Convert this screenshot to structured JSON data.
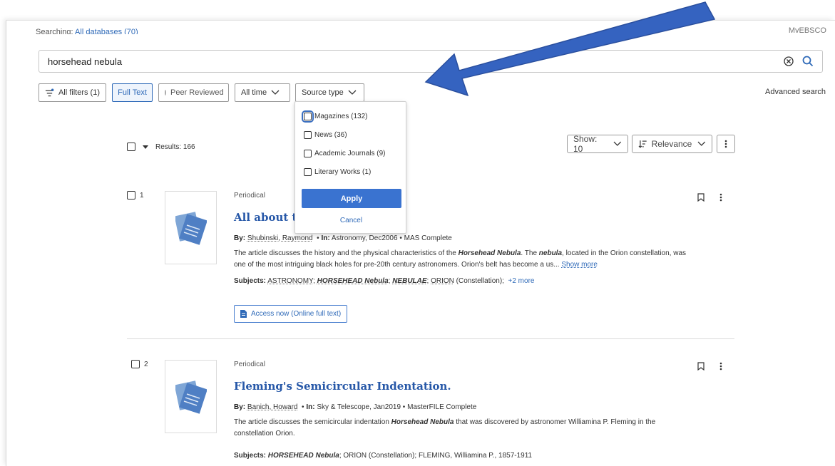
{
  "header": {
    "searching_label": "Searching:",
    "database_label": "All databases (70)",
    "my_box_label": "MyEBSCO"
  },
  "search": {
    "query": "horsehead nebula",
    "placeholder": ""
  },
  "filters": {
    "all_filters": "All filters (1)",
    "full_text": "Full Text",
    "peer_reviewed": "Peer Reviewed",
    "all_time": "All time",
    "source_type": "Source type",
    "advanced_search": "Advanced search"
  },
  "source_type_menu": {
    "options": [
      {
        "label": "Magazines (132)",
        "checked": false
      },
      {
        "label": "News (36)",
        "checked": false
      },
      {
        "label": "Academic Journals (9)",
        "checked": false
      },
      {
        "label": "Literary Works (1)",
        "checked": false
      }
    ],
    "apply": "Apply",
    "cancel": "Cancel"
  },
  "results_bar": {
    "count_label": "Results: 166",
    "show": "Show: 10",
    "sort": "Relevance"
  },
  "results": [
    {
      "number": "1",
      "type": "Periodical",
      "title": "All about th",
      "by_label": "By:",
      "author": "Shubinski, Raymond",
      "in_label": "In:",
      "source": "Astronomy, Dec2006 • MAS Complete",
      "abstract_pre": "The article discusses the history and the physical characteristics of the ",
      "abstract_hl1": "Horsehead Nebula",
      "abstract_mid": ". The ",
      "abstract_hl2": "nebula",
      "abstract_post": ", located in the Orion constellation, was one of the most intriguing black holes for pre-20th century astronomers. Orion's belt has become a us...",
      "show_more": "Show more",
      "subjects_label": "Subjects:",
      "subject_1": "ASTRONOMY",
      "subject_2": "HORSEHEAD Nebula",
      "subject_3": "NEBULAE",
      "subject_4": "ORION",
      "subject_4_suffix": "(Constellation);",
      "subjects_more": "+2 more",
      "access": "Access now (Online full text)"
    },
    {
      "number": "2",
      "type": "Periodical",
      "title": "Fleming's Semicircular Indentation.",
      "by_label": "By:",
      "author": "Banich, Howard",
      "in_label": "In:",
      "source": "Sky & Telescope, Jan2019 • MasterFILE Complete",
      "abstract_pre": "The article discusses the semicircular indentation ",
      "abstract_hl1": "Horsehead Nebula",
      "abstract_post": " that was discovered by astronomer Williamina P. Fleming in the constellation Orion.",
      "subjects_label": "Subjects:",
      "subject_1": "HORSEHEAD Nebula",
      "subject_rest": "; ORION (Constellation); FLEMING, Williamina P., 1857-1911"
    }
  ],
  "colors": {
    "accent": "#2f6ab8",
    "arrow": "#3563c0"
  }
}
